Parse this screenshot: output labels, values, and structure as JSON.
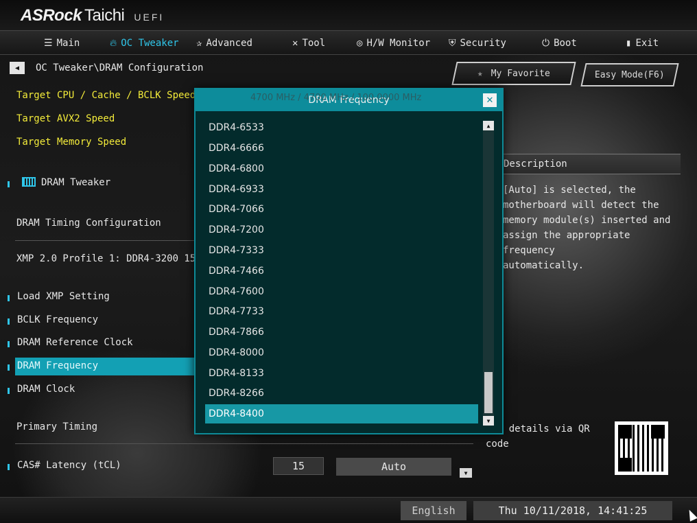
{
  "brand": {
    "name": "ASRock",
    "series": "Taichi",
    "suffix": "UEFI"
  },
  "nav": {
    "tabs": [
      {
        "label": "Main",
        "icon": "list-icon"
      },
      {
        "label": "OC Tweaker",
        "icon": "flame-icon",
        "active": true
      },
      {
        "label": "Advanced",
        "icon": "star-icon"
      },
      {
        "label": "Tool",
        "icon": "tools-icon"
      },
      {
        "label": "H/W Monitor",
        "icon": "monitor-icon"
      },
      {
        "label": "Security",
        "icon": "shield-icon"
      },
      {
        "label": "Boot",
        "icon": "power-icon"
      },
      {
        "label": "Exit",
        "icon": "exit-icon"
      }
    ]
  },
  "breadcrumb": "OC Tweaker\\DRAM Configuration",
  "buttons": {
    "favorite": "My Favorite",
    "easy_mode": "Easy Mode(F6)"
  },
  "left": {
    "target_cpu": "Target CPU / Cache / BCLK Speed",
    "target_avx2": "Target AVX2 Speed",
    "target_memory": "Target Memory Speed",
    "dram_tweaker": "DRAM Tweaker",
    "dram_timing_config": "DRAM Timing Configuration",
    "xmp_profile": "XMP 2.0 Profile 1: DDR4-3200 15-1",
    "items": [
      "Load XMP Setting",
      "BCLK Frequency",
      "DRAM Reference Clock",
      "DRAM Frequency",
      "DRAM Clock"
    ],
    "primary_timing": "Primary Timing",
    "cas_label": "CAS# Latency (tCL)"
  },
  "cas": {
    "value": "15",
    "mode": "Auto"
  },
  "description": {
    "title": "Description",
    "text": "[Auto] is selected, the\nmotherboard will detect the\nmemory module(s) inserted and\nassign the appropriate frequency\nautomatically."
  },
  "qr": {
    "label": "Get details via QR\ncode"
  },
  "bottom": {
    "language": "English",
    "datetime": "Thu 10/11/2018, 14:41:25"
  },
  "modal": {
    "title": "DRAM Frequency",
    "ghost_text": "4700 MHz / 4700 MHz / 100.0000 MHz",
    "options": [
      "DDR4-6533",
      "DDR4-6666",
      "DDR4-6800",
      "DDR4-6933",
      "DDR4-7066",
      "DDR4-7200",
      "DDR4-7333",
      "DDR4-7466",
      "DDR4-7600",
      "DDR4-7733",
      "DDR4-7866",
      "DDR4-8000",
      "DDR4-8133",
      "DDR4-8266",
      "DDR4-8400"
    ],
    "selected_index": 14
  },
  "colors": {
    "accent": "#2fc6ea",
    "highlight": "#13a0b4",
    "yellow": "#f4ec3a",
    "modal_header": "#0d8c9b"
  }
}
